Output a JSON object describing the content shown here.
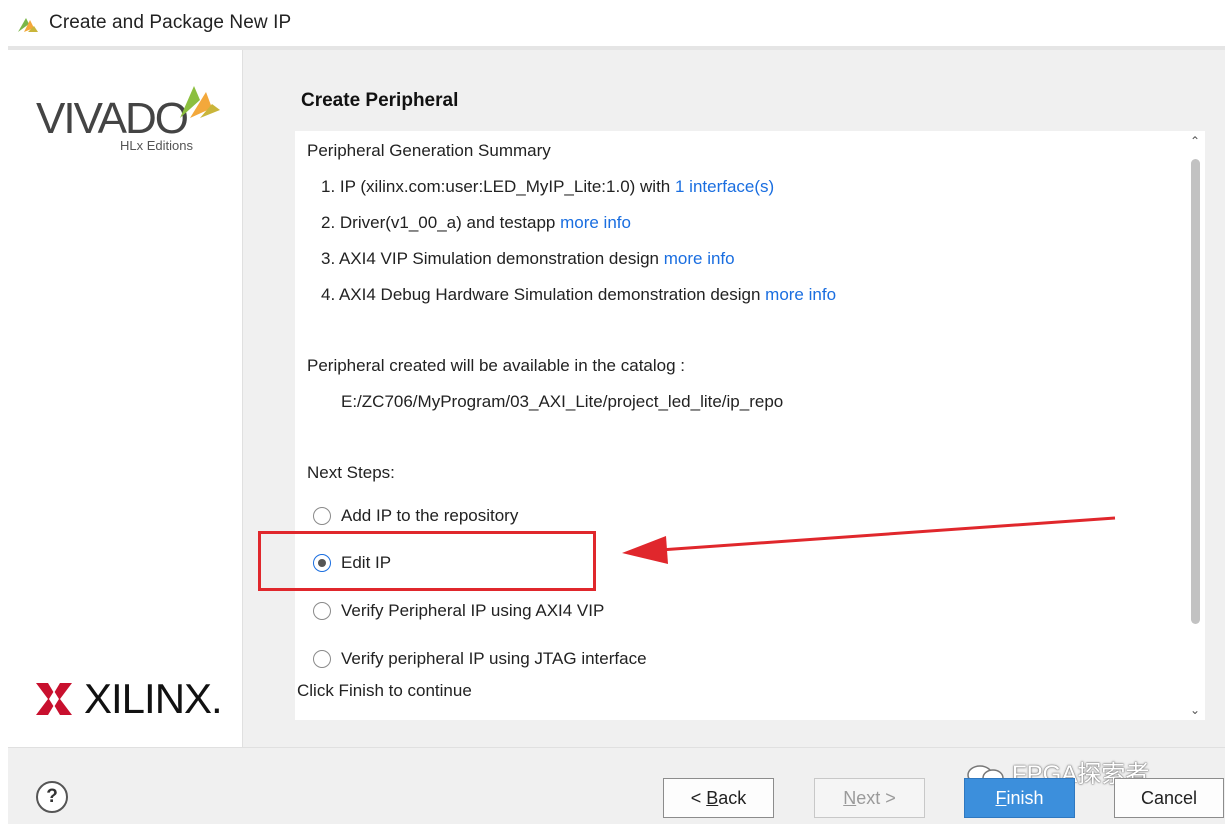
{
  "window": {
    "title": "Create and Package New IP"
  },
  "sidebar": {
    "brand_top": "VIVADO",
    "brand_sub": "HLx Editions",
    "brand_bottom": "XILINX."
  },
  "page": {
    "title": "Create Peripheral",
    "summary_heading": "Peripheral Generation Summary",
    "items": [
      {
        "text": "1. IP (xilinx.com:user:LED_MyIP_Lite:1.0) with ",
        "link": "1 interface(s)"
      },
      {
        "text": "2. Driver(v1_00_a) and testapp ",
        "link": "more info"
      },
      {
        "text": "3. AXI4 VIP Simulation demonstration design ",
        "link": "more info"
      },
      {
        "text": "4. AXI4 Debug Hardware Simulation demonstration design ",
        "link": "more info"
      }
    ],
    "catalog_text": "Peripheral created will be available in the catalog :",
    "catalog_path": "E:/ZC706/MyProgram/03_AXI_Lite/project_led_lite/ip_repo",
    "next_steps_label": "Next Steps:",
    "options": [
      {
        "label": "Add IP to the repository",
        "selected": false
      },
      {
        "label": "Edit IP",
        "selected": true
      },
      {
        "label": "Verify Peripheral IP using AXI4 VIP",
        "selected": false
      },
      {
        "label": "Verify peripheral IP using JTAG interface",
        "selected": false
      }
    ],
    "finish_message": "Click Finish to continue"
  },
  "footer": {
    "help_label": "?",
    "back_prefix": "< ",
    "back_mnemonic": "B",
    "back_rest": "ack",
    "next_mnemonic": "N",
    "next_rest": "ext >",
    "finish_mnemonic": "F",
    "finish_rest": "inish",
    "cancel_label": "Cancel"
  },
  "watermark": {
    "text": "FPGA探索者"
  },
  "colors": {
    "link": "#1a6ee0",
    "highlight": "#e0272c",
    "finish_button": "#3c8fdc"
  }
}
